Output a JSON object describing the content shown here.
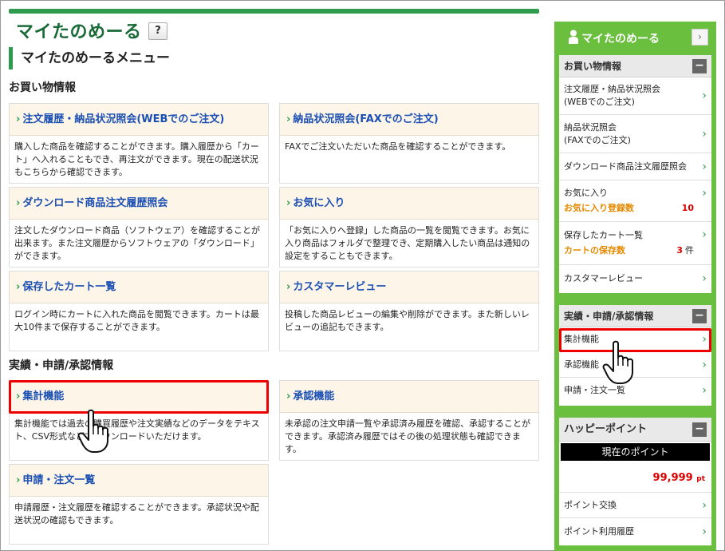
{
  "page": {
    "title": "マイたのめーる",
    "help_label": "?",
    "menu_title": "マイたのめーるメニュー"
  },
  "sections": {
    "shopping": "お買い物情報",
    "results": "実績・申請/承認情報"
  },
  "cards": {
    "order_history": {
      "title": "注文履歴・納品状況照会(WEBでのご注文)",
      "body": "購入した商品を確認することができます。購入履歴から「カート」へ入れることもでき、再注文ができます。現在の配送状況もこちらから確認できます。"
    },
    "fax_status": {
      "title": "納品状況照会(FAXでのご注文)",
      "body": "FAXでご注文いただいた商品を確認することができます。"
    },
    "download_history": {
      "title": "ダウンロード商品注文履歴照会",
      "body": "注文したダウンロード商品（ソフトウェア）を確認することが出来ます。また注文履歴からソフトウェアの「ダウンロード」ができます。"
    },
    "favorites": {
      "title": "お気に入り",
      "body": "「お気に入りへ登録」した商品の一覧を閲覧できます。お気に入り商品はフォルダで整理でき、定期購入したい商品は通知の設定をすることもできます。"
    },
    "saved_cart": {
      "title": "保存したカート一覧",
      "body": "ログイン時にカートに入れた商品を閲覧できます。カートは最大10件まで保存することができます。"
    },
    "customer_review": {
      "title": "カスタマーレビュー",
      "body": "投稿した商品レビューの編集や削除ができます。また新しいレビューの追記もできます。"
    },
    "aggregate": {
      "title": "集計機能",
      "body": "集計機能では過去の購買履歴や注文実績などのデータをテキスト、CSV形式などでダウンロードいただけます。"
    },
    "approval": {
      "title": "承認機能",
      "body": "未承認の注文申請一覧や承認済み履歴を確認、承認することができます。承認済み履歴ではその後の処理状態も確認できます。"
    },
    "applications": {
      "title": "申請・注文一覧",
      "body": "申請履歴・注文履歴を確認することができます。承認状況や配送状況の確認もできます。"
    }
  },
  "sidebar": {
    "title": "マイたのめーる",
    "toggle_label": "›",
    "shopping": {
      "head": "お買い物情報",
      "collapse": "−",
      "items": [
        "注文履歴・納品状況照会",
        "(WEBでのご注文)",
        "納品状況照会",
        "(FAXでのご注文)",
        "ダウンロード商品注文履歴照会",
        "お気に入り",
        "保存したカート一覧",
        "カスタマーレビュー"
      ],
      "favorites_count_label": "お気に入り登録数",
      "favorites_count": "10",
      "cart_count_label": "カートの保存数",
      "cart_count": "3",
      "cart_count_unit": "件"
    },
    "results": {
      "head": "実績・申請/承認情報",
      "collapse": "−",
      "items": [
        "集計機能",
        "承認機能",
        "申請・注文一覧"
      ]
    },
    "points": {
      "head": "ハッピーポイント",
      "collapse": "−",
      "current_label": "現在のポイント",
      "value": "99,999",
      "unit": "pt",
      "items": [
        "ポイント交換",
        "ポイント利用履歴"
      ]
    }
  },
  "colors": {
    "brand_green": "#2e9a4e",
    "sidebar_green": "#6bbf3f",
    "link_blue": "#1a4fb4",
    "highlight_red": "#e00000"
  }
}
